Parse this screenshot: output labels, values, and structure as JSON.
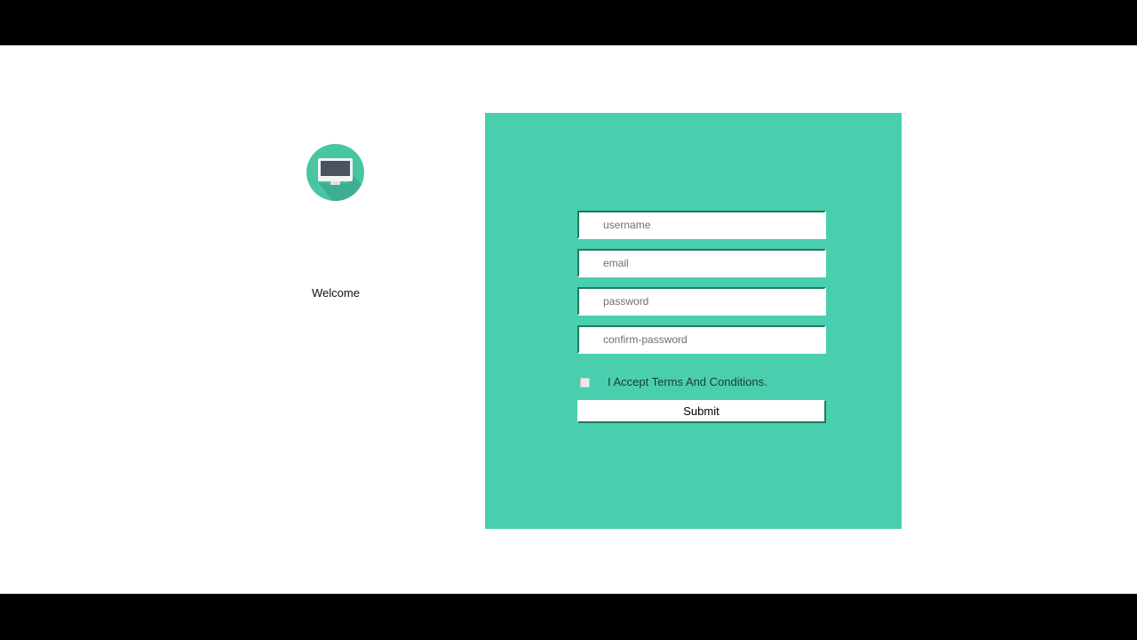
{
  "sidebar": {
    "icon": "monitor-icon",
    "welcome_text": "Welcome"
  },
  "form": {
    "username_placeholder": "username",
    "email_placeholder": "email",
    "password_placeholder": "password",
    "confirm_password_placeholder": "confirm-password",
    "terms_label": "I Accept Terms And Conditions.",
    "terms_checked": false,
    "submit_label": "Submit"
  },
  "colors": {
    "card_background": "#49cfae",
    "badge_background": "#48c5a3",
    "field_border": "#1f7a63",
    "monitor_screen": "#4a5460"
  }
}
